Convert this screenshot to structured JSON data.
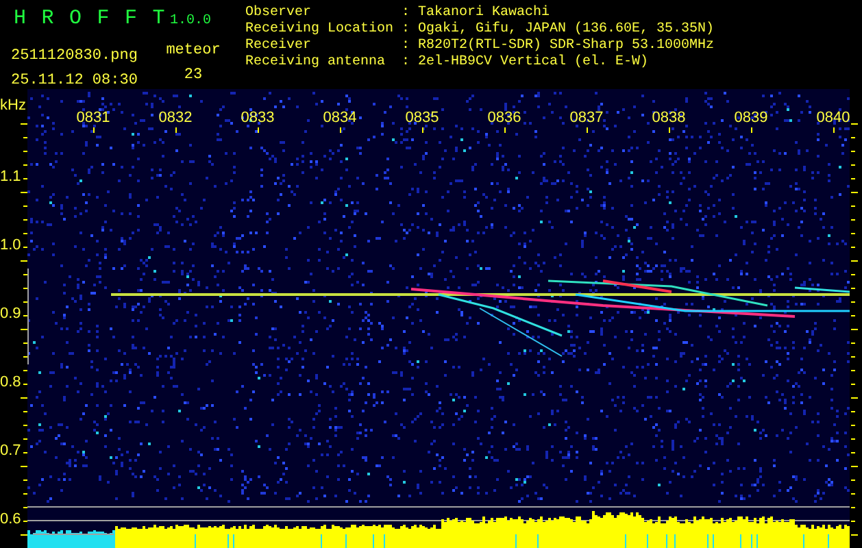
{
  "app": {
    "name": "HROFFT",
    "version": "1.0.0"
  },
  "file": {
    "name": "2511120830.png",
    "timestamp": "25.11.12 08:30"
  },
  "meteor": {
    "label": "meteor",
    "count": "23"
  },
  "info": {
    "separator": ":",
    "rows": [
      {
        "label": "Observer",
        "value": "Takanori Kawachi"
      },
      {
        "label": "Receiving Location",
        "value": "Ogaki, Gifu, JAPAN (136.60E, 35.35N)"
      },
      {
        "label": "Receiver",
        "value": "R820T2(RTL-SDR) SDR-Sharp 53.1000MHz"
      },
      {
        "label": "Receiving antenna",
        "value": "2el-HB9CV Vertical (el. E-W)"
      }
    ]
  },
  "spectrogram": {
    "unit": "kHz",
    "frequency_labels": [
      "1.1",
      "1.0",
      "0.9",
      "0.8",
      "0.7",
      "0.6"
    ],
    "time_labels": [
      "0831",
      "0832",
      "0833",
      "0834",
      "0835",
      "0836",
      "0837",
      "0838",
      "0839",
      "0840"
    ]
  }
}
